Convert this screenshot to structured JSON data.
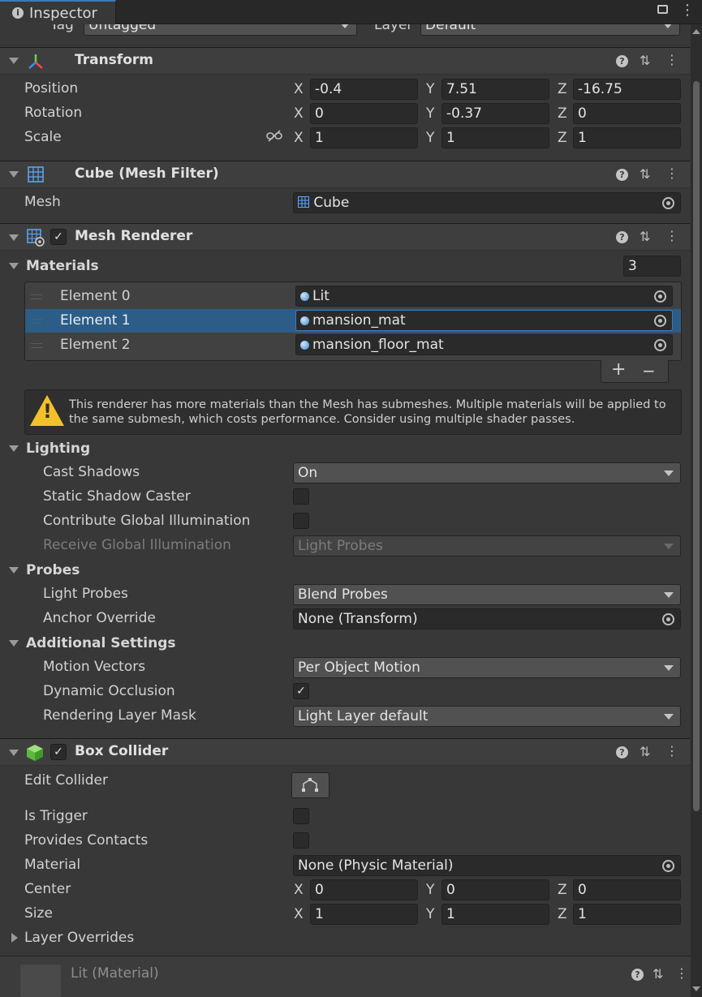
{
  "tab": {
    "title": "Inspector"
  },
  "header": {
    "tag_label": "Tag",
    "tag_value": "Untagged",
    "layer_label": "Layer",
    "layer_value": "Default"
  },
  "transform": {
    "title": "Transform",
    "position": {
      "label": "Position",
      "x": "-0.4",
      "y": "7.51",
      "z": "-16.75"
    },
    "rotation": {
      "label": "Rotation",
      "x": "0",
      "y": "-0.37",
      "z": "0"
    },
    "scale": {
      "label": "Scale",
      "x": "1",
      "y": "1",
      "z": "1"
    }
  },
  "axes": {
    "x": "X",
    "y": "Y",
    "z": "Z"
  },
  "mesh_filter": {
    "title": "Cube (Mesh Filter)",
    "mesh_label": "Mesh",
    "mesh_value": "Cube"
  },
  "mesh_renderer": {
    "title": "Mesh Renderer",
    "materials": {
      "label": "Materials",
      "count": "3",
      "elements": [
        {
          "label": "Element 0",
          "value": "Lit"
        },
        {
          "label": "Element 1",
          "value": "mansion_mat"
        },
        {
          "label": "Element 2",
          "value": "mansion_floor_mat"
        }
      ],
      "add": "+",
      "remove": "−"
    },
    "warning": "This renderer has more materials than the Mesh has submeshes. Multiple materials will be applied to the same submesh, which costs performance. Consider using multiple shader passes.",
    "lighting": {
      "label": "Lighting",
      "cast_shadows_label": "Cast Shadows",
      "cast_shadows_value": "On",
      "static_shadow_label": "Static Shadow Caster",
      "contribute_gi_label": "Contribute Global Illumination",
      "receive_gi_label": "Receive Global Illumination",
      "receive_gi_value": "Light Probes"
    },
    "probes": {
      "label": "Probes",
      "light_probes_label": "Light Probes",
      "light_probes_value": "Blend Probes",
      "anchor_label": "Anchor Override",
      "anchor_value": "None (Transform)"
    },
    "additional": {
      "label": "Additional Settings",
      "motion_label": "Motion Vectors",
      "motion_value": "Per Object Motion",
      "dyn_occ_label": "Dynamic Occlusion",
      "rlm_label": "Rendering Layer Mask",
      "rlm_value": "Light Layer default"
    }
  },
  "box_collider": {
    "title": "Box Collider",
    "edit_label": "Edit Collider",
    "trigger_label": "Is Trigger",
    "contacts_label": "Provides Contacts",
    "material_label": "Material",
    "material_value": "None (Physic Material)",
    "center": {
      "label": "Center",
      "x": "0",
      "y": "0",
      "z": "0"
    },
    "size": {
      "label": "Size",
      "x": "1",
      "y": "1",
      "z": "1"
    },
    "layer_overrides": "Layer Overrides"
  },
  "footer": {
    "title": "Lit (Material)"
  },
  "checks": {
    "tick": "✓"
  },
  "icons": {
    "help": "?",
    "settings": "⇅",
    "more": "⋮"
  },
  "colors": {
    "accent": "#3a79bb",
    "selection": "#2c5d87",
    "warning": "#f4c02a",
    "collider_green": "#6cd04a"
  }
}
